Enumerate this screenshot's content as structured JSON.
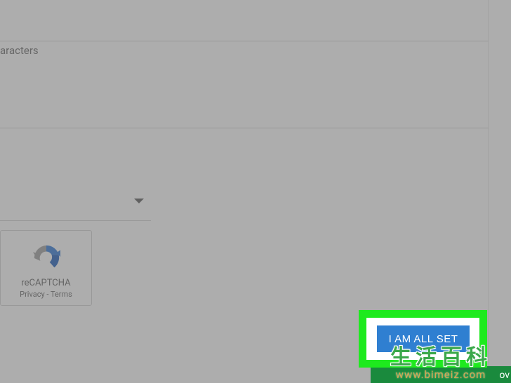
{
  "form": {
    "helper_text": "aracters"
  },
  "recaptcha": {
    "label": "reCAPTCHA",
    "privacy": "Privacy - Terms"
  },
  "submit": {
    "label": "I AM ALL SET"
  },
  "watermark": {
    "chinese": "生活百科",
    "domain": "www.bimeiz.com"
  },
  "footer": {
    "partial_text": "ov"
  }
}
